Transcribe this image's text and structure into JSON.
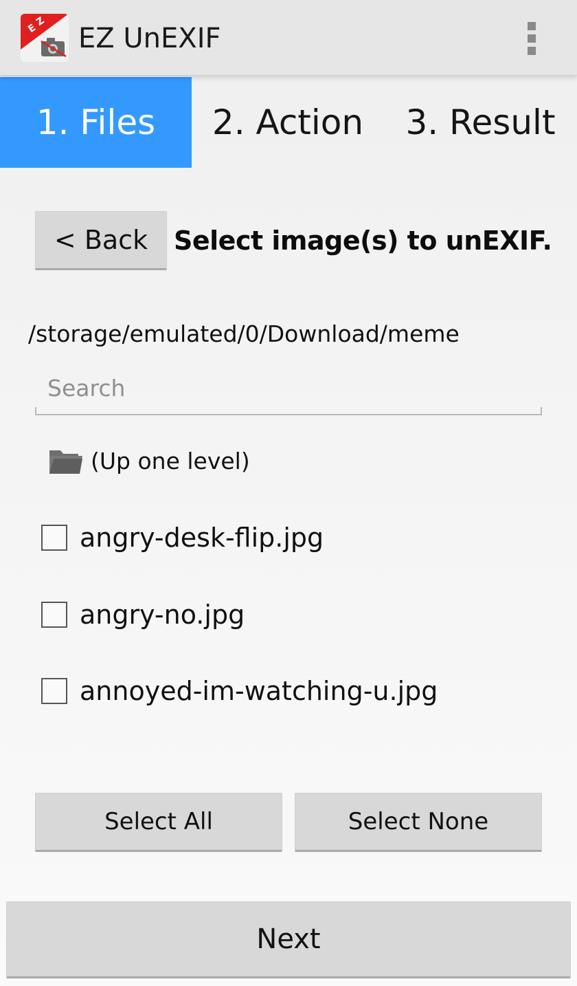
{
  "app": {
    "title": "EZ UnEXIF",
    "icon_letters": "E Z",
    "accent_color": "#3399ff"
  },
  "tabs": [
    {
      "label": "1. Files",
      "active": true
    },
    {
      "label": "2. Action",
      "active": false
    },
    {
      "label": "3. Result",
      "active": false
    }
  ],
  "files_step": {
    "back_label": "< Back",
    "instruction": "Select image(s) to unEXIF.",
    "current_path": "/storage/emulated/0/Download/meme",
    "search": {
      "placeholder": "Search",
      "value": ""
    },
    "up_level_label": "(Up one level)",
    "files": [
      {
        "name": "angry-desk-flip.jpg",
        "checked": false
      },
      {
        "name": "angry-no.jpg",
        "checked": false
      },
      {
        "name": "annoyed-im-watching-u.jpg",
        "checked": false
      }
    ],
    "select_all_label": "Select All",
    "select_none_label": "Select None",
    "next_label": "Next"
  },
  "icons": {
    "app": "camera-icon",
    "overflow": "overflow-menu-icon",
    "folder": "folder-icon",
    "checkbox": "checkbox-icon"
  }
}
